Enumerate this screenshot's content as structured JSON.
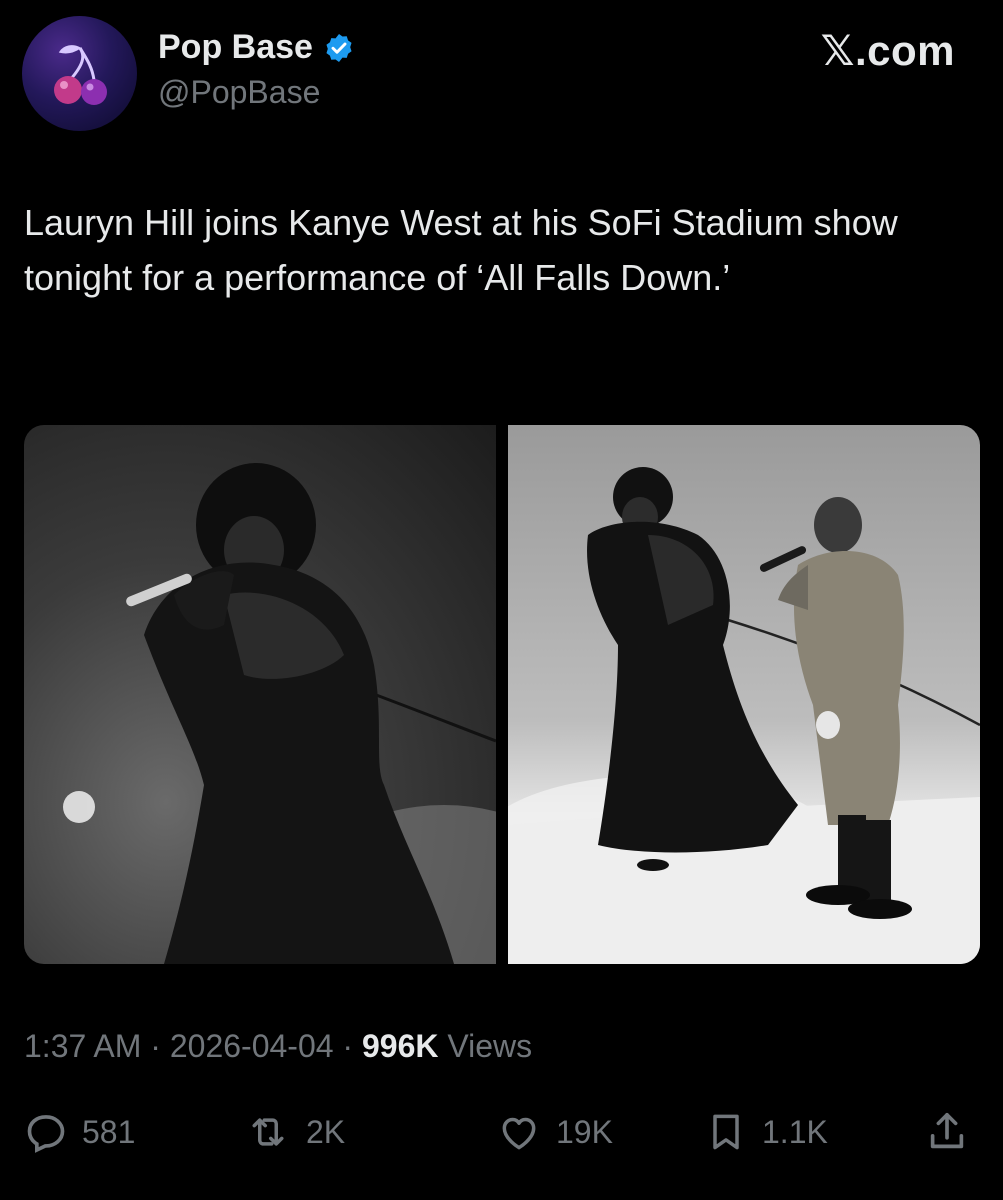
{
  "author": {
    "display_name": "Pop Base",
    "handle": "@PopBase",
    "verified": true,
    "avatar_icon": "cherries-icon"
  },
  "brand": {
    "label": "𝕏.com"
  },
  "post": {
    "text": "Lauryn Hill joins Kanye West at his SoFi Stadium show tonight for a performance of ‘All Falls Down.’",
    "media": [
      {
        "icon": "photo-performer-icon"
      },
      {
        "icon": "photo-duo-performance-icon"
      }
    ],
    "time": "1:37 AM",
    "date": "2026-04-04",
    "views_count": "996K",
    "views_label": "Views",
    "separator": " · "
  },
  "actions": {
    "replies": "581",
    "reposts": "2K",
    "likes": "19K",
    "bookmarks": "1.1K"
  },
  "colors": {
    "background": "#000000",
    "text": "#e7e9ea",
    "secondary": "#71767b",
    "verified": "#1d9bf0"
  }
}
